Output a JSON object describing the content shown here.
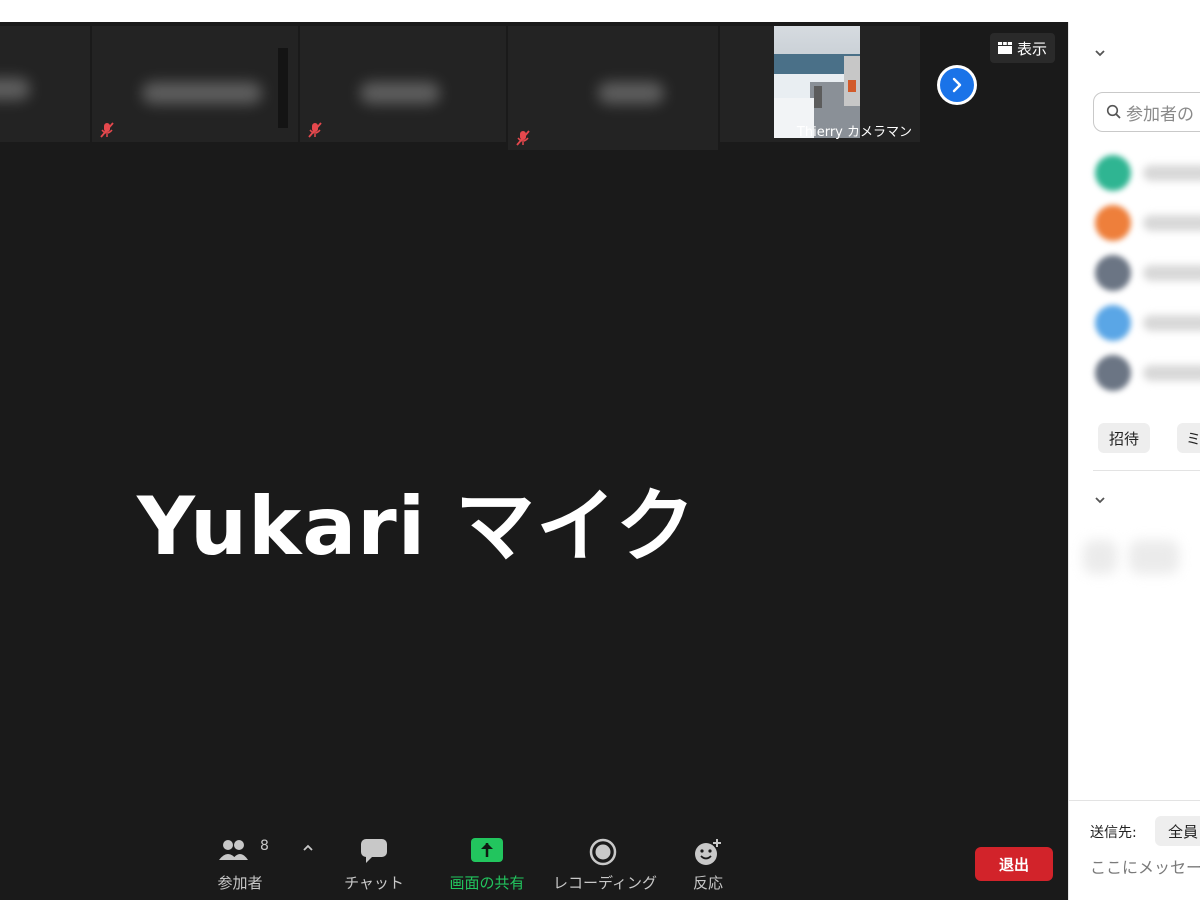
{
  "meeting": {
    "view_label": "表示",
    "active_speaker_name": "Yukari マイク",
    "thumbnails": [
      {
        "id": "t1",
        "name": "Thierry カメラマン",
        "muted": false,
        "video": true
      }
    ]
  },
  "toolbar": {
    "participants_label": "参加者",
    "participants_count": "8",
    "chat_label": "チャット",
    "share_label": "画面の共有",
    "record_label": "レコーディング",
    "reactions_label": "反応",
    "leave_label": "退出"
  },
  "panel": {
    "search_placeholder": "参加者の",
    "invite_label": "招待",
    "mute_all_label": "ミ",
    "send_to_label": "送信先:",
    "send_to_value": "全員",
    "message_placeholder": "ここにメッセージ"
  },
  "colors": {
    "stage_bg": "#1a1a1a",
    "accent_blue": "#1a73e8",
    "share_green": "#22c55e",
    "leave_red": "#d2232a",
    "muted_red": "#e5484d"
  },
  "icons": {
    "mute": "mic-muted-icon",
    "next": "chevron-right-icon",
    "view": "grid-icon",
    "participants": "people-icon",
    "chat": "chat-icon",
    "share": "share-up-icon",
    "record": "record-icon",
    "reactions": "emoji-plus-icon",
    "search": "search-icon"
  }
}
